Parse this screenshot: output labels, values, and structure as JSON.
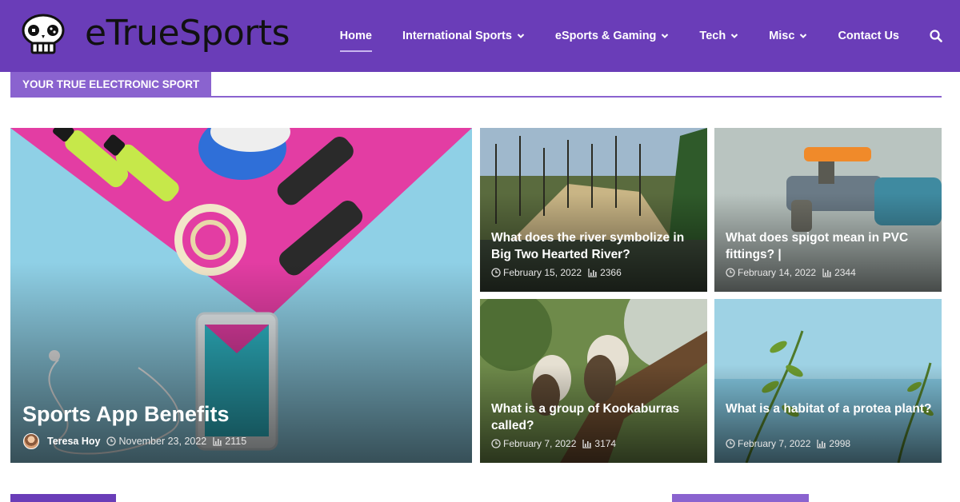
{
  "brand": {
    "name": "eTrueSports",
    "logo_icon": "skull-gamepad-icon"
  },
  "nav": {
    "items": [
      {
        "label": "Home",
        "active": true,
        "dropdown": false
      },
      {
        "label": "International Sports",
        "dropdown": true
      },
      {
        "label": "eSports & Gaming",
        "dropdown": true
      },
      {
        "label": "Tech",
        "dropdown": true
      },
      {
        "label": "Misc",
        "dropdown": true
      },
      {
        "label": "Contact Us",
        "dropdown": false
      }
    ],
    "search_icon": "search-icon"
  },
  "tagline": "YOUR TRUE ELECTRONIC SPORT",
  "featured": {
    "title": "Sports App Benefits",
    "author": "Teresa Hoy",
    "date": "November 23, 2022",
    "views": "2115"
  },
  "posts": [
    {
      "title": "What does the river symbolize in Big Two Hearted River?",
      "date": "February 15, 2022",
      "views": "2366"
    },
    {
      "title": "What does spigot mean in PVC fittings? |",
      "date": "February 14, 2022",
      "views": "2344"
    },
    {
      "title": "What is a group of Kookaburras called?",
      "date": "February 7, 2022",
      "views": "3174"
    },
    {
      "title": "What is a habitat of a protea plant?",
      "date": "February 7, 2022",
      "views": "2998"
    }
  ],
  "colors": {
    "header": "#6a3db8",
    "accent": "#8a63cf"
  }
}
